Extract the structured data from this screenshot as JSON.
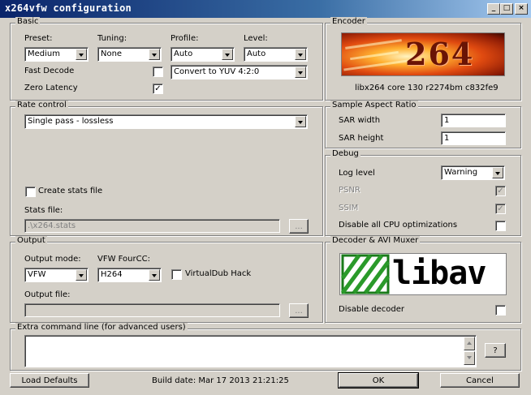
{
  "window": {
    "title": "x264vfw configuration",
    "min_glyph": "_",
    "max_glyph": "□",
    "close_glyph": "×"
  },
  "basic": {
    "legend": "Basic",
    "preset_label": "Preset:",
    "preset_value": "Medium",
    "tuning_label": "Tuning:",
    "tuning_value": "None",
    "profile_label": "Profile:",
    "profile_value": "Auto",
    "level_label": "Level:",
    "level_value": "Auto",
    "fast_decode_label": "Fast Decode",
    "zero_latency_label": "Zero Latency",
    "colorspace_value": "Convert to YUV 4:2:0",
    "check_mark": "✓"
  },
  "encoder": {
    "legend": "Encoder",
    "logo_text": "264",
    "version": "libx264 core 130 r2274bm c832fe9"
  },
  "rate_control": {
    "legend": "Rate control",
    "mode_value": "Single pass - lossless",
    "create_stats_label": "Create stats file",
    "stats_file_label": "Stats file:",
    "stats_file_value": ".\\x264.stats",
    "browse_label": "..."
  },
  "sar": {
    "legend": "Sample Aspect Ratio",
    "width_label": "SAR width",
    "width_value": "1",
    "height_label": "SAR height",
    "height_value": "1"
  },
  "debug": {
    "legend": "Debug",
    "log_level_label": "Log level",
    "log_level_value": "Warning",
    "psnr_label": "PSNR",
    "ssim_label": "SSIM",
    "disable_cpu_label": "Disable all CPU optimizations",
    "check_mark": "✓"
  },
  "output": {
    "legend": "Output",
    "mode_label": "Output mode:",
    "mode_value": "VFW",
    "fourcc_label": "VFW FourCC:",
    "fourcc_value": "H264",
    "virtualdub_label": "VirtualDub Hack",
    "file_label": "Output file:",
    "file_value": "",
    "browse_label": "..."
  },
  "decoder": {
    "legend": "Decoder & AVI Muxer",
    "logo_text": "libav",
    "disable_decoder_label": "Disable decoder"
  },
  "extra": {
    "legend": "Extra command line (for advanced users)",
    "value": "",
    "help_label": "?"
  },
  "footer": {
    "load_defaults_label": "Load Defaults",
    "build_date": "Build date: Mar 17 2013 21:21:25",
    "ok_label": "OK",
    "cancel_label": "Cancel"
  }
}
